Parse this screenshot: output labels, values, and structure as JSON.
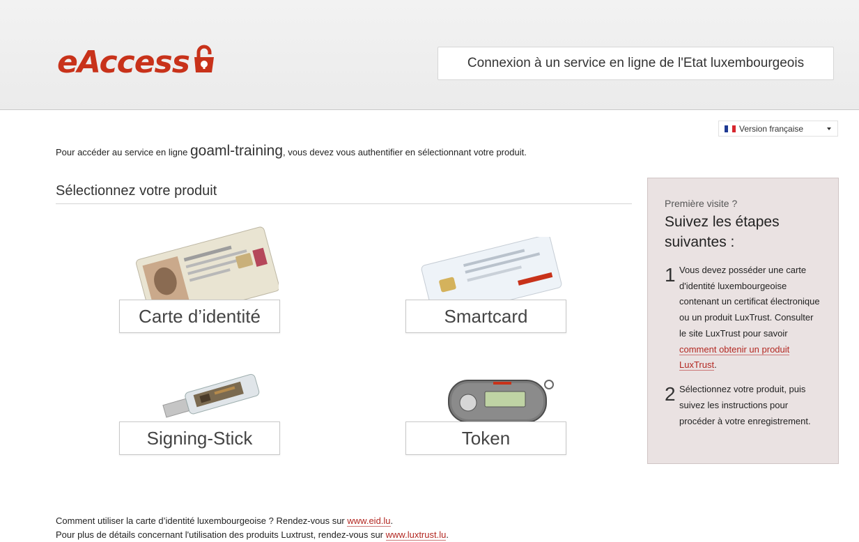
{
  "header": {
    "logo_text": "eAccess",
    "service_title": "Connexion à un service en ligne de l'Etat luxembourgeois"
  },
  "language": {
    "selected": "Version française"
  },
  "intro": {
    "prefix": "Pour accéder au service en ligne",
    "service_name": "goaml-training",
    "suffix": ", vous devez vous authentifier en sélectionnant votre produit."
  },
  "main": {
    "section_title": "Sélectionnez votre produit",
    "products": [
      {
        "label": "Carte d’identité"
      },
      {
        "label": "Smartcard"
      },
      {
        "label": "Signing-Stick"
      },
      {
        "label": "Token"
      }
    ]
  },
  "sidebar": {
    "first_visit": "Première visite ?",
    "title": "Suivez les étapes suivantes :",
    "steps": [
      {
        "number": "1",
        "text": "Vous devez posséder une carte d'identité luxembourgeoise contenant un certificat électronique ou un produit LuxTrust. Consulter le site LuxTrust pour savoir",
        "link": "comment obtenir un produit LuxTrust",
        "after": "."
      },
      {
        "number": "2",
        "text": "Sélectionnez votre produit, puis suivez les instructions pour procéder à votre enregistrement."
      }
    ]
  },
  "footer": {
    "line1_text": "Comment utiliser la carte d’identité luxembourgeoise ? Rendez-vous sur",
    "line1_link": "www.eid.lu",
    "line2_text": "Pour plus de détails concernant l'utilisation des produits Luxtrust, rendez-vous sur",
    "line2_link": "www.luxtrust.lu",
    "end": "."
  },
  "colors": {
    "brand": "#c8321a",
    "sidebar_bg": "#eae2e2",
    "link": "#b32822"
  }
}
